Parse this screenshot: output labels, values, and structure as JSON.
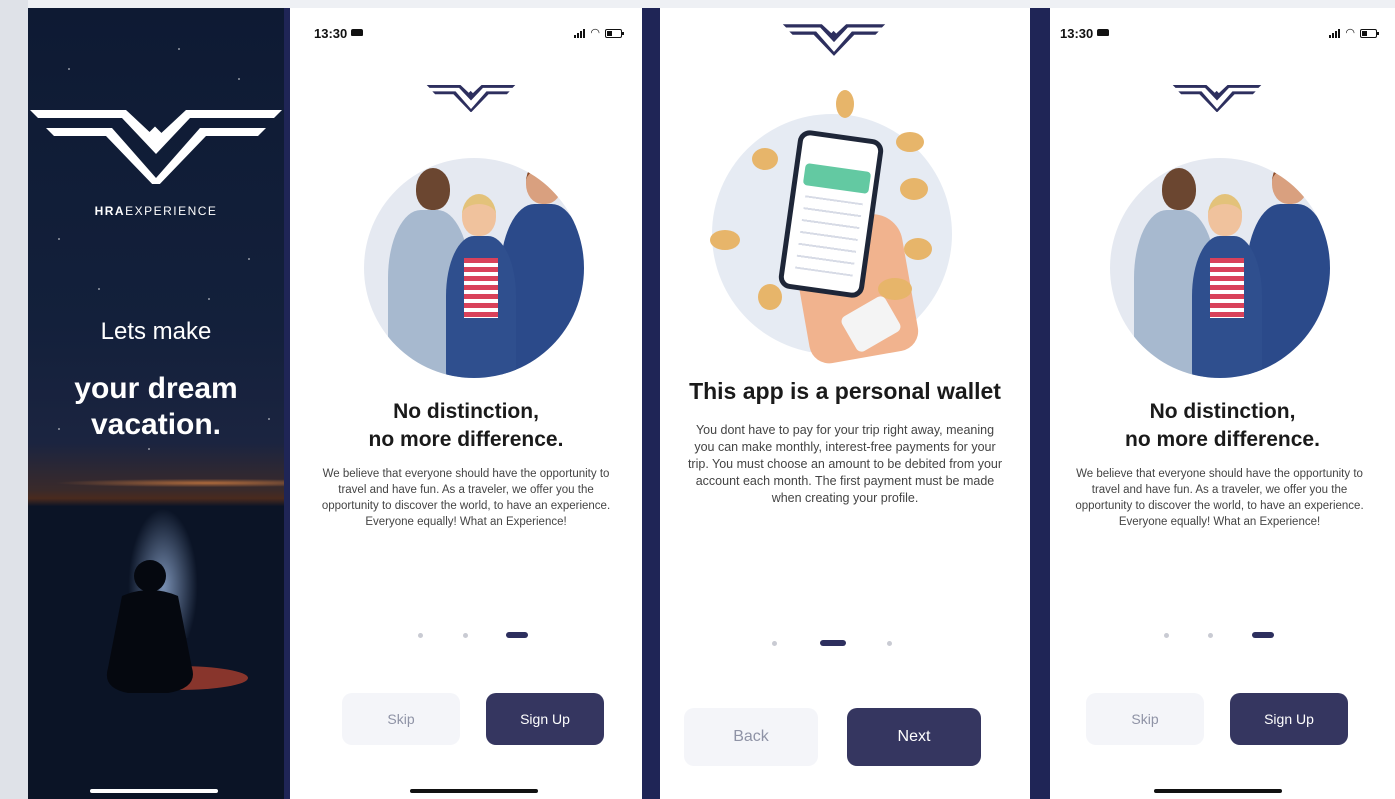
{
  "colors": {
    "navy": "#1f2556",
    "button_primary": "#353660",
    "button_secondary": "#f4f5f9",
    "dot_active": "#2d2f5e",
    "dot_inactive": "#c9cbd3"
  },
  "splash": {
    "brand_bold": "HRA",
    "brand_light": "EXPERIENCE",
    "line1": "Lets make",
    "line2": "your dream",
    "line3": "vacation."
  },
  "onboarding_people": {
    "status_time": "13:30",
    "title_line1": "No distinction,",
    "title_line2": "no more difference.",
    "description": "We believe that everyone should have the opportunity to travel and have fun. As a traveler, we offer you the opportunity to discover the world, to have an experience. Everyone equally! What an Experience!",
    "skip_label": "Skip",
    "signup_label": "Sign Up",
    "page_index": 3,
    "page_count": 3
  },
  "onboarding_wallet": {
    "title": "This app is a personal wallet",
    "description": "You dont have to pay for your trip right away, meaning you can make monthly, interest-free payments for your trip. You must choose an amount to be debited from your account each month. The first payment must be made when creating your profile.",
    "back_label": "Back",
    "next_label": "Next",
    "page_index": 2,
    "page_count": 3
  },
  "onboarding_people_copy": {
    "status_time": "13:30",
    "title_line1": "No distinction,",
    "title_line2": "no more difference.",
    "description": "We believe that everyone should have the opportunity to travel and have fun. As a traveler, we offer you the opportunity to discover the world, to have an experience. Everyone equally! What an Experience!",
    "skip_label": "Skip",
    "signup_label": "Sign Up",
    "page_index": 3,
    "page_count": 3
  }
}
